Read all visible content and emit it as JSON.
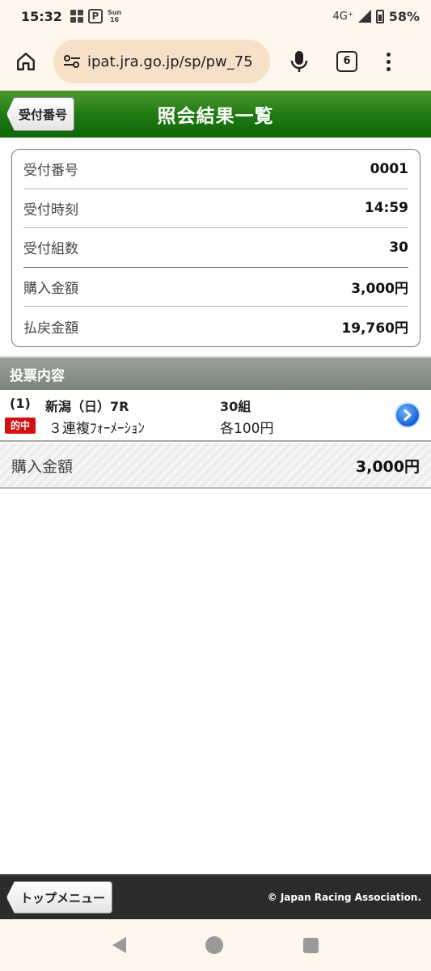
{
  "status_bar": {
    "time": "15:32",
    "day": "Sun",
    "date": "16",
    "network": "4G⁺",
    "battery": "58%"
  },
  "browser": {
    "url": "ipat.jra.go.jp/sp/pw_75",
    "tab_count": "6"
  },
  "header": {
    "back_label": "受付番号",
    "title": "照会結果一覧"
  },
  "summary": {
    "rows": [
      {
        "label": "受付番号",
        "value": "0001"
      },
      {
        "label": "受付時刻",
        "value": "14:59"
      },
      {
        "label": "受付組数",
        "value": "30"
      },
      {
        "label": "購入金額",
        "value": "3,000円"
      },
      {
        "label": "払戻金額",
        "value": "19,760円"
      }
    ]
  },
  "section": {
    "title": "投票内容"
  },
  "bet": {
    "number": "(1)",
    "hit_badge": "的中",
    "race": "新潟（日）7R",
    "type": "３連複ﾌｫｰﾒｰｼｮﾝ",
    "count": "30組",
    "unit": "各100円"
  },
  "purchase_total": {
    "label": "購入金額",
    "value": "3,000円"
  },
  "footer": {
    "top_menu_label": "トップメニュー",
    "copyright": "© Japan Racing Association."
  },
  "colors": {
    "header_green": "#1f7a12",
    "hit_red": "#d50f0f",
    "detail_blue": "#1560d6",
    "chrome_bg": "#fff6ec"
  }
}
